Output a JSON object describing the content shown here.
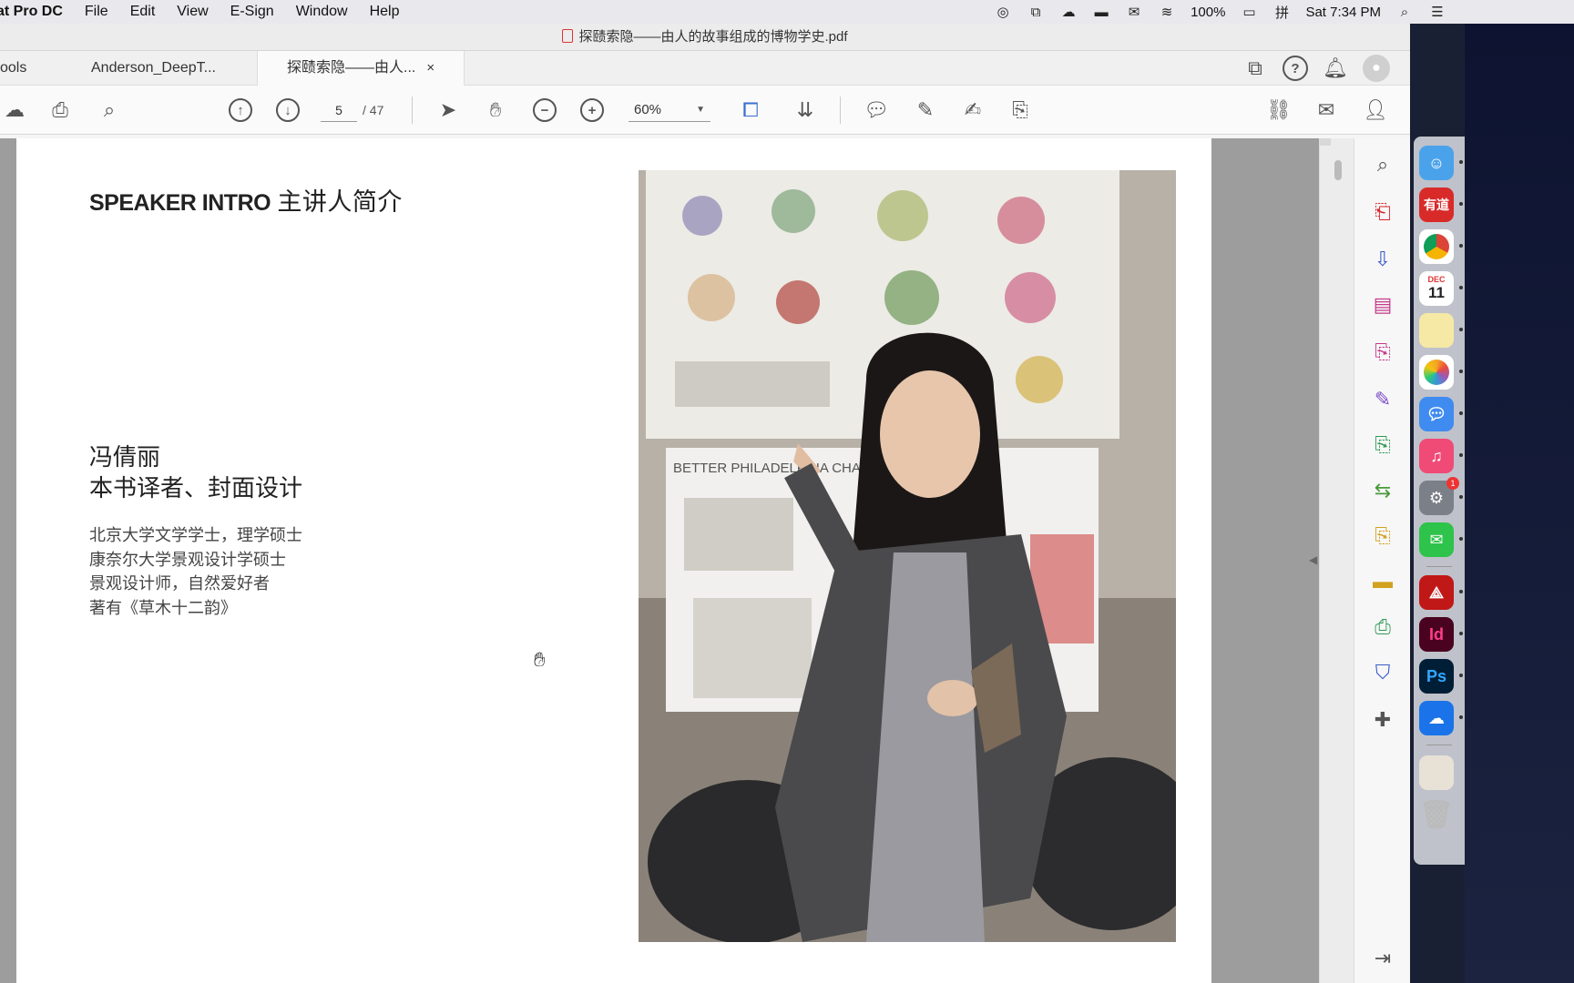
{
  "menubar": {
    "app_name": "at Pro DC",
    "items": [
      "File",
      "Edit",
      "View",
      "E-Sign",
      "Window",
      "Help"
    ],
    "battery": "100%",
    "clock": "Sat 7:34 PM"
  },
  "window": {
    "title": "探赜索隐——由人的故事组成的博物学史.pdf"
  },
  "tabs": {
    "tools_label": "ools",
    "tab1": "Anderson_DeepT...",
    "tab2": "探赜索隐——由人...",
    "close": "×"
  },
  "toolbar": {
    "page_current": "5",
    "page_total": "/ 47",
    "zoom": "60%"
  },
  "document": {
    "speaker_title_en": "SPEAKER INTRO",
    "speaker_title_zh": "主讲人简介",
    "name": "冯倩丽",
    "role": "本书译者、封面设计",
    "bio": [
      "北京大学文学学士，理学硕士",
      "康奈尔大学景观设计学硕士",
      "景观设计师，自然爱好者",
      "著有《草木十二韵》"
    ],
    "poster_text": "BETTER PHILADELPHIA CHALLEN"
  },
  "dock": {
    "youdao": "有道",
    "calendar_month": "DEC",
    "calendar_day": "11",
    "indesign": "Id",
    "photoshop": "Ps",
    "badge": "1"
  },
  "colors": {
    "accent_red": "#d7262a",
    "toolbar_icon": "#555555"
  }
}
